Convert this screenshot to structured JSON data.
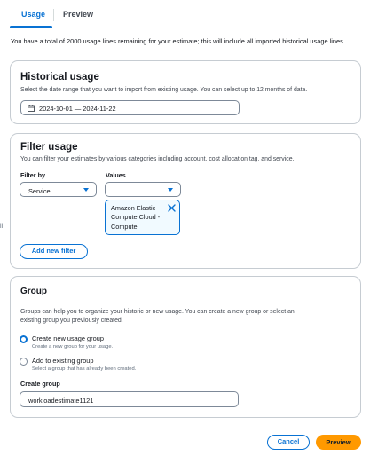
{
  "tabs": [
    {
      "label": "Usage",
      "active": true
    },
    {
      "label": "Preview",
      "active": false
    }
  ],
  "intro_text": "You have a total of 2000 usage lines remaining for your estimate; this will include all imported historical usage lines.",
  "historical": {
    "title": "Historical usage",
    "description": "Select the date range that you want to import from existing usage. You can select up to 12 months of data.",
    "date_range": "2024-10-01 — 2024-11-22"
  },
  "filter": {
    "title": "Filter usage",
    "description": "You can filter your estimates by various categories including account, cost allocation tag, and service.",
    "filter_by_label": "Filter by",
    "filter_by_value": "Service",
    "values_label": "Values",
    "values_value": "",
    "token_text": "Amazon Elastic Compute Cloud - Compute",
    "add_filter_label": "Add new filter"
  },
  "group": {
    "title": "Group",
    "description_line1": "Groups can help you to organize your historic or new usage. You can create a new group or select an",
    "description_line2": "existing group you previously created.",
    "options": [
      {
        "label": "Create new usage group",
        "description": "Create a new group for your usage.",
        "selected": true
      },
      {
        "label": "Add to existing group",
        "description": "Select a group that has already been created.",
        "selected": false
      }
    ],
    "create_label": "Create group",
    "create_value": "workloadestimate1121"
  },
  "footer": {
    "cancel_label": "Cancel",
    "preview_label": "Preview"
  },
  "edge_mark": "ll",
  "colors": {
    "accent": "#0972d3",
    "primary_button": "#ff9900",
    "border": "#c6ccd2"
  }
}
